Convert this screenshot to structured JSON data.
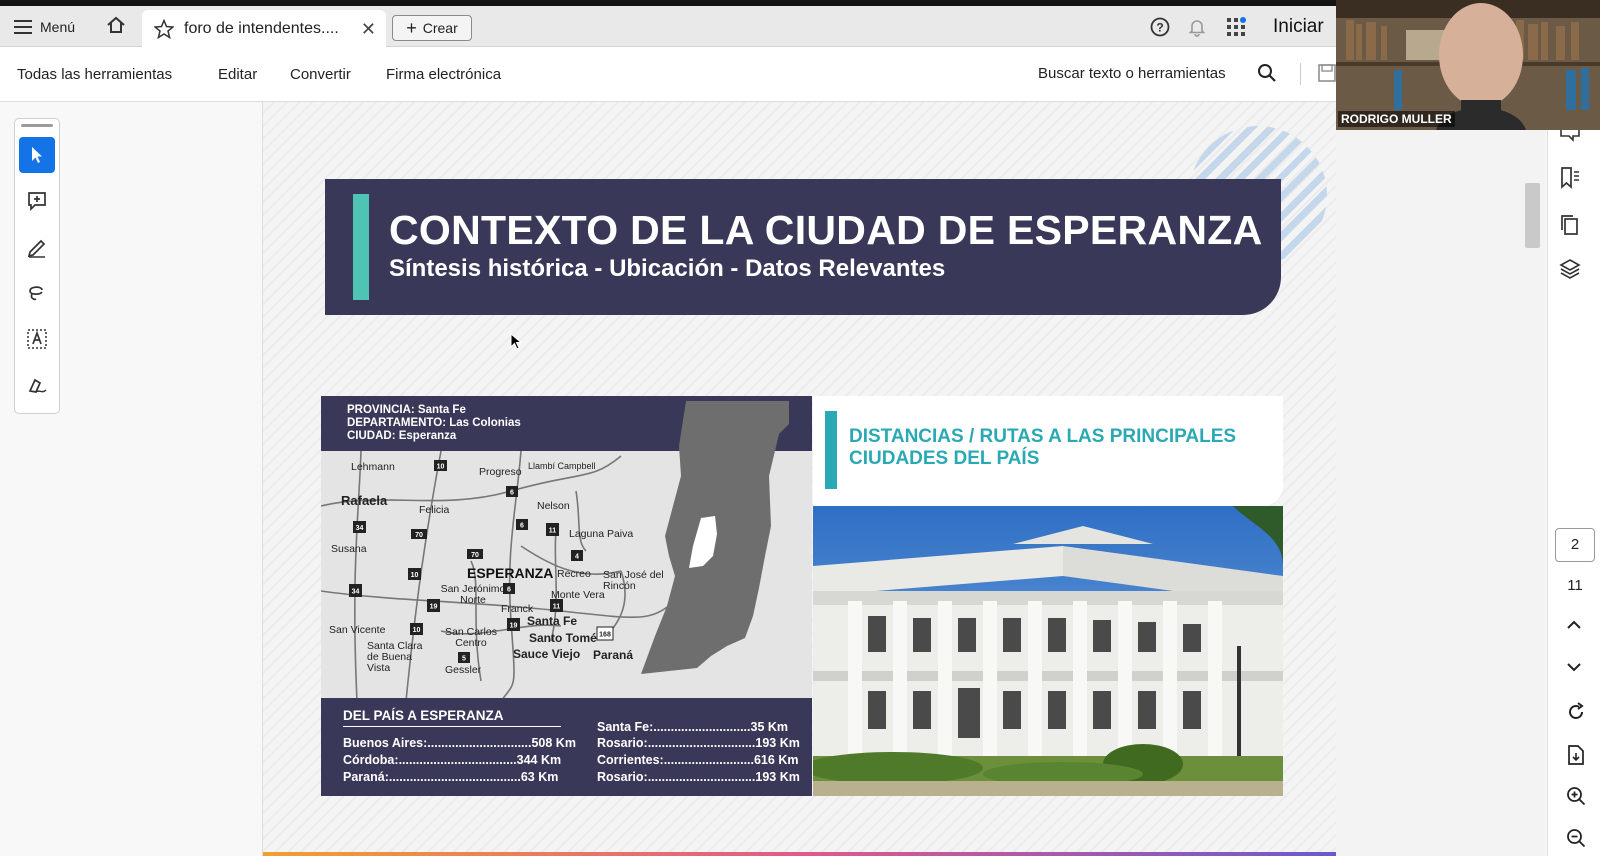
{
  "tabbar": {
    "menu_label": "Menú",
    "tab_title": "foro de intendentes....",
    "create_label": "Crear",
    "signin_label": "Iniciar"
  },
  "toolbar": {
    "items": [
      "Todas las herramientas",
      "Editar",
      "Convertir",
      "Firma electrónica"
    ],
    "search_label": "Buscar texto o herramientas"
  },
  "slide": {
    "title": "CONTEXTO DE LA CIUDAD DE ESPERANZA",
    "subtitle": "Síntesis histórica - Ubicación - Datos Relevantes",
    "map_header": [
      "PROVINCIA: Santa Fe",
      "DEPARTAMENTO: Las Colonias",
      "CIUDAD: Esperanza"
    ],
    "towns": [
      "Lehmann",
      "Progreso",
      "Llambí Campbell",
      "Rafaela",
      "Felicia",
      "Nelson",
      "Susana",
      "Laguna Paiva",
      "ESPERANZA",
      "Recreo",
      "San José del Rincón",
      "San Jerónimo Norte",
      "Monte Vera",
      "Franck",
      "San Vicente",
      "San Carlos Centro",
      "Santa Fe",
      "Santo Tomé",
      "Santa Clara de Buena Vista",
      "Sauce Viejo",
      "Paraná",
      "Gessler"
    ],
    "route_numbers": [
      "10",
      "6",
      "34",
      "70",
      "4",
      "11",
      "19",
      "168",
      "5"
    ],
    "dist_heading": "DEL PAÍS A ESPERANZA",
    "distances_left": [
      {
        "city": "Buenos Aires:",
        "km": "508 Km"
      },
      {
        "city": "Córdoba:",
        "km": "344 Km"
      },
      {
        "city": "Paraná:",
        "km": "63 Km"
      }
    ],
    "distances_right": [
      {
        "city": "Santa Fe:",
        "km": "35 Km"
      },
      {
        "city": "Rosario:",
        "km": "193 Km"
      },
      {
        "city": "Corrientes:",
        "km": "616 Km"
      },
      {
        "city": "Rosario:",
        "km": "193 Km"
      }
    ],
    "dist_title_line1": "DISTANCIAS / RUTAS A LAS PRINCIPALES",
    "dist_title_line2": "CIUDADES DEL PAÍS"
  },
  "pager": {
    "current": "2",
    "total": "11"
  },
  "webcam": {
    "name": "RODRIGO MULLER"
  },
  "colors": {
    "navy": "#3a3858",
    "teal": "#4fc3b4",
    "accent_blue": "#1473e6"
  }
}
